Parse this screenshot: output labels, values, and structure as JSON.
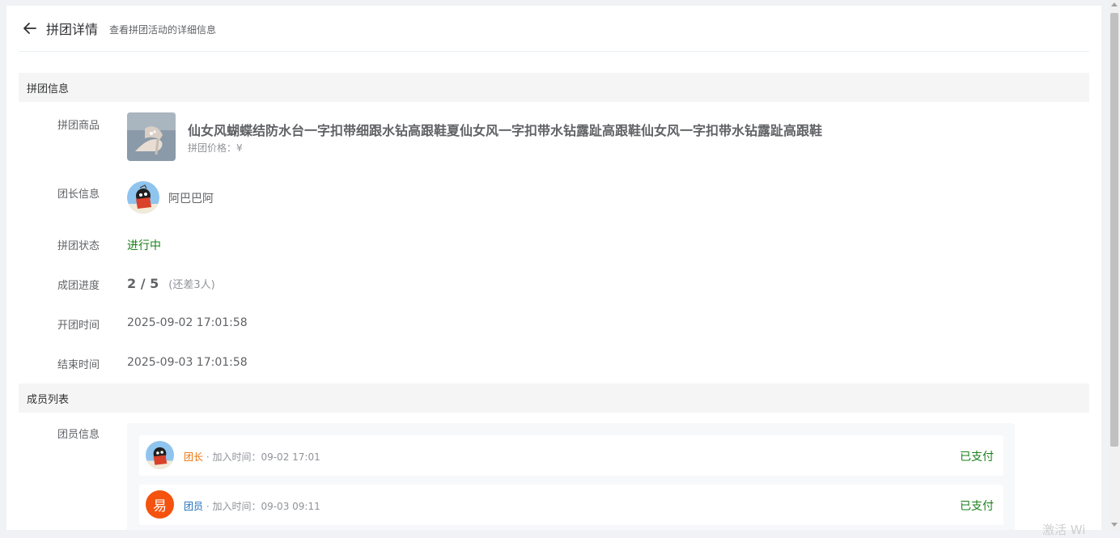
{
  "header": {
    "title": "拼团详情",
    "subtitle": "查看拼团活动的详细信息",
    "back_icon": "arrow-left-icon"
  },
  "sections": {
    "info_title": "拼团信息",
    "members_title": "成员列表"
  },
  "info": {
    "product_label": "拼团商品",
    "product_title": "仙女风蝴蝶结防水台一字扣带细跟水钻高跟鞋夏仙女风一字扣带水钻露趾高跟鞋仙女风一字扣带水钻露趾高跟鞋",
    "product_price": "拼团价格：¥",
    "leader_label": "团长信息",
    "leader_name": "阿巴巴阿",
    "status_label": "拼团状态",
    "status_value": "进行中",
    "progress_label": "成团进度",
    "progress_value": "2 / 5",
    "progress_diff": "(还差3人)",
    "progress_current": 2,
    "progress_total": 5,
    "start_label": "开团时间",
    "start_value": "2025-09-02 17:01:58",
    "end_label": "结束时间",
    "end_value": "2025-09-03 17:01:58"
  },
  "members": {
    "label": "团员信息",
    "items": [
      {
        "role": "团长",
        "meta": " · 加入时间：09-02 17:01",
        "pay_status": "已支付",
        "avatar": "photo"
      },
      {
        "role": "团员",
        "meta": " · 加入时间：09-03 09:11",
        "pay_status": "已支付",
        "avatar_text": "易"
      }
    ]
  },
  "watermark": "激活 Wi",
  "colors": {
    "leader_role": "#e6740d",
    "member_role": "#1e6bb8",
    "status_green": "#1a7f1a",
    "avatar_orange": "#f4520e",
    "section_bg": "#f5f5f5"
  }
}
